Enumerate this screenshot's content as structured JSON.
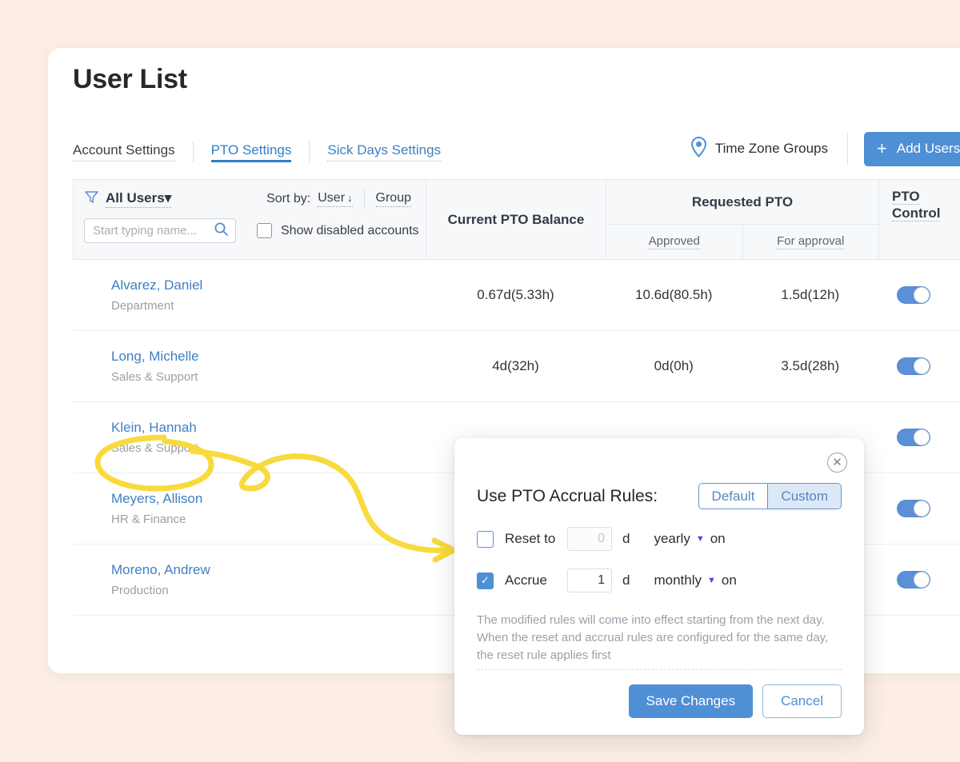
{
  "page": {
    "title": "User List",
    "background_color": "#fceee4",
    "accent_color": "#4f8fd6",
    "link_color": "#3f7fc1",
    "annotation_color": "#f7d93c"
  },
  "tabs": [
    {
      "label": "Account Settings",
      "active": false
    },
    {
      "label": "PTO Settings",
      "active": true
    },
    {
      "label": "Sick Days Settings",
      "active": false
    }
  ],
  "header_actions": {
    "time_zone_groups": "Time Zone Groups",
    "time_zone_icon": "location-pin-icon",
    "add_users": "Add Users",
    "add_users_plus": "+",
    "add_users_caret": "▾"
  },
  "filter": {
    "filter_icon": "funnel-icon",
    "all_users": "All Users",
    "all_users_caret": "▾",
    "sort_by_label": "Sort by:",
    "sort_user": "User",
    "sort_user_arrow": "↓",
    "sort_group": "Group",
    "search_placeholder": "Start typing name...",
    "search_value": "",
    "search_icon": "search-icon",
    "show_disabled": "Show disabled accounts",
    "show_disabled_checked": false
  },
  "table": {
    "columns": {
      "current_balance": "Current PTO Balance",
      "requested": "Requested PTO",
      "approved": "Approved",
      "for_approval": "For approval",
      "pto_control_line1": "PTO",
      "pto_control_line2": "Control"
    },
    "rows": [
      {
        "name": "Alvarez, Daniel",
        "department": "Department",
        "balance": "0.67d(5.33h)",
        "approved": "10.6d(80.5h)",
        "for_approval": "1.5d(12h)",
        "pto_control_on": true
      },
      {
        "name": "Long, Michelle",
        "department": "Sales & Support",
        "balance": "4d(32h)",
        "approved": "0d(0h)",
        "for_approval": "3.5d(28h)",
        "pto_control_on": true
      },
      {
        "name": "Klein, Hannah",
        "department": "Sales & Support",
        "balance": "",
        "approved": "",
        "for_approval": "",
        "pto_control_on": true
      },
      {
        "name": "Meyers, Allison",
        "department": "HR & Finance",
        "balance": "",
        "approved": "",
        "for_approval": "",
        "pto_control_on": true
      },
      {
        "name": "Moreno, Andrew",
        "department": "Production",
        "balance": "",
        "approved": "",
        "for_approval": "",
        "pto_control_on": true
      }
    ]
  },
  "modal": {
    "close_icon": "close-circle-icon",
    "title": "Use PTO Accrual Rules:",
    "segmented": {
      "default_label": "Default",
      "custom_label": "Custom",
      "selected": "Custom"
    },
    "reset_rule": {
      "checked": false,
      "label": "Reset to",
      "value": "0",
      "unit": "d",
      "frequency": "yearly",
      "caret": "▼",
      "on_label": "on"
    },
    "accrue_rule": {
      "checked": true,
      "check_glyph": "✓",
      "label": "Accrue",
      "value": "1",
      "unit": "d",
      "frequency": "monthly",
      "caret": "▼",
      "on_label": "on"
    },
    "note": "The modified rules will come into effect starting from the next day. When the reset and accrual rules are configured for the same day, the reset rule applies first",
    "save_label": "Save Changes",
    "cancel_label": "Cancel"
  },
  "annotation": {
    "kind": "hand-drawn-highlight",
    "target_user": "Klein, Hannah",
    "points_to": "reset-to-checkbox"
  }
}
